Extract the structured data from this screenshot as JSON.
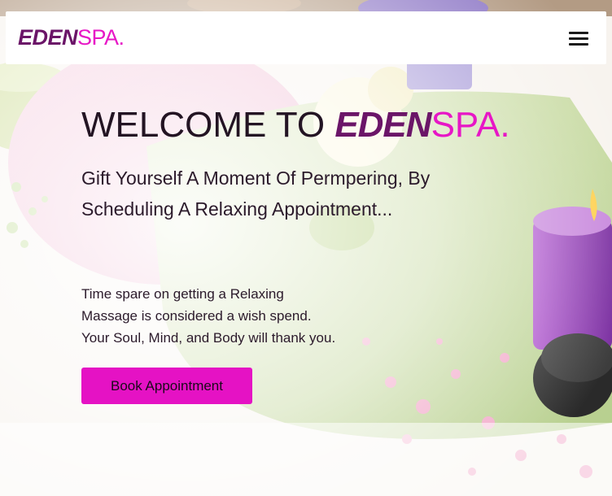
{
  "brand": {
    "part1": "EDEN",
    "part2": "SPA."
  },
  "hero": {
    "heading_prefix": "WELCOME TO ",
    "heading_brand1": "EDEN",
    "heading_brand2": "SPA.",
    "subtitle": "Gift Yourself A Moment Of Permpering, By Scheduling A Relaxing Appointment...",
    "description_lines": [
      "Time spare on getting a Relaxing",
      "Massage is considered a wish spend.",
      "Your Soul, Mind, and Body will thank you."
    ],
    "cta_label": "Book Appointment"
  },
  "icons": {
    "menu": "hamburger-menu-icon"
  },
  "colors": {
    "brand_purple": "#6b1568",
    "brand_pink": "#e716c6",
    "cta": "#e512c4"
  }
}
